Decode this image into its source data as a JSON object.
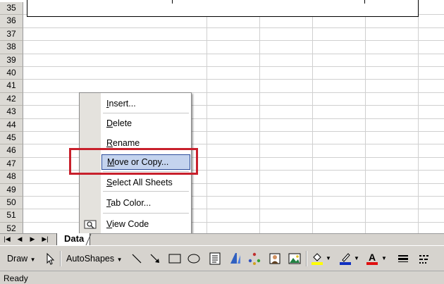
{
  "rows": [
    "35",
    "36",
    "37",
    "38",
    "39",
    "40",
    "41",
    "42",
    "43",
    "44",
    "45",
    "46",
    "47",
    "48",
    "49",
    "50",
    "51",
    "52"
  ],
  "context_menu": {
    "items": [
      {
        "label": "Insert...",
        "mnemonic": "I"
      },
      {
        "label": "Delete",
        "mnemonic": "D"
      },
      {
        "label": "Rename",
        "mnemonic": "R"
      },
      {
        "label": "Move or Copy...",
        "mnemonic": "M",
        "highlighted": true
      },
      {
        "label": "Select All Sheets",
        "mnemonic": "S"
      },
      {
        "label": "Tab Color...",
        "mnemonic": "T"
      },
      {
        "label": "View Code",
        "mnemonic": "V",
        "icon": "view-code-icon"
      }
    ]
  },
  "sheet_tabs": {
    "nav_buttons": [
      "first-sheet-icon",
      "prev-sheet-icon",
      "next-sheet-icon",
      "last-sheet-icon"
    ],
    "tabs": [
      {
        "label": "Data",
        "active": true
      }
    ]
  },
  "drawing_toolbar": {
    "draw_label": "Draw",
    "autoshapes_label": "AutoShapes",
    "tools": [
      "select-objects-icon",
      "line-icon",
      "arrow-icon",
      "rectangle-icon",
      "oval-icon",
      "text-box-icon",
      "wordart-icon",
      "diagram-icon",
      "clip-art-icon",
      "picture-icon",
      "fill-color-icon",
      "line-color-icon",
      "font-color-icon",
      "line-style-icon",
      "dash-style-icon"
    ]
  },
  "status_bar": {
    "text": "Ready"
  },
  "colors": {
    "highlight_border": "#c8202c",
    "menu_selection": "#c4d3ee",
    "fill_color": "#ffff00",
    "line_color": "#1030c0",
    "font_color": "#e01010"
  }
}
